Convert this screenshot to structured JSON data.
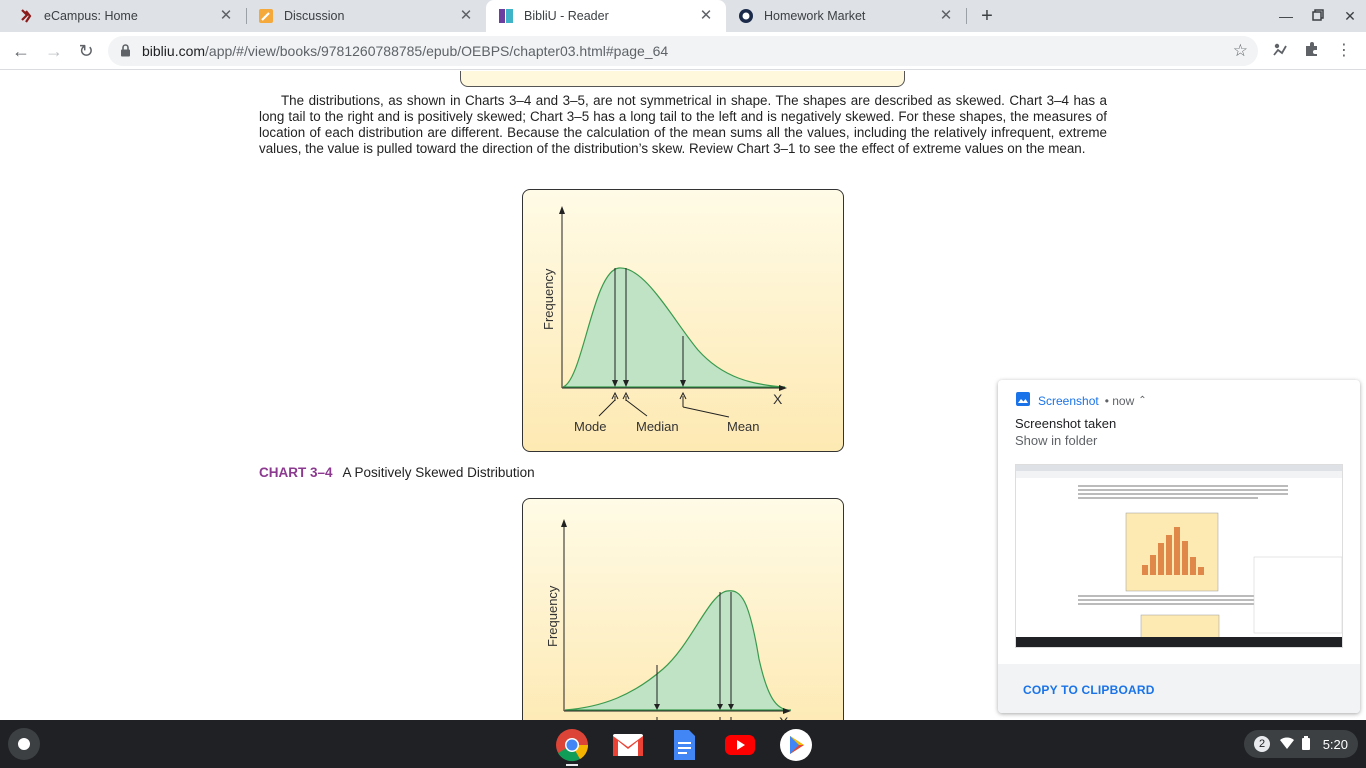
{
  "tabs": [
    {
      "title": "eCampus: Home",
      "active": false
    },
    {
      "title": "Discussion",
      "active": false
    },
    {
      "title": "BibliU - Reader",
      "active": true
    },
    {
      "title": "Homework Market",
      "active": false
    }
  ],
  "address": {
    "host": "bibliu.com",
    "path": "/app/#/view/books/9781260788785/epub/OEBPS/chapter03.html#page_64"
  },
  "book": {
    "paragraph": "The distributions, as shown in Charts 3–4 and 3–5, are not symmetrical in shape. The shapes are described as skewed. Chart 3–4 has a long tail to the right and is positively skewed; Chart 3–5 has a long tail to the left and is negatively skewed. For these shapes, the measures of location of each distribution are different. Because the calculation of the mean sums all the values, including the relatively infrequent, extreme values, the value is pulled toward the direction of the distribution’s skew. Review Chart 3–1 to see the effect of extreme values on the mean.",
    "chart1": {
      "ylabel": "Frequency",
      "xlabel": "X",
      "mode_label": "Mode",
      "median_label": "Median",
      "mean_label": "Mean"
    },
    "chart1_caption_number": "CHART 3–4",
    "chart1_caption_text": "A Positively Skewed Distribution",
    "chart2": {
      "ylabel": "Frequency",
      "xlabel": "X"
    }
  },
  "notification": {
    "app": "Screenshot",
    "time": "now",
    "title": "Screenshot taken",
    "subtitle": "Show in folder",
    "action": "COPY TO CLIPBOARD"
  },
  "tray": {
    "badge": "2",
    "time": "5:20"
  },
  "colors": {
    "accent": "#1a73e8",
    "chart_fill": "#bfe3c4",
    "chart_stroke": "#3a9a4e",
    "caption_number": "#8b3a8f"
  }
}
